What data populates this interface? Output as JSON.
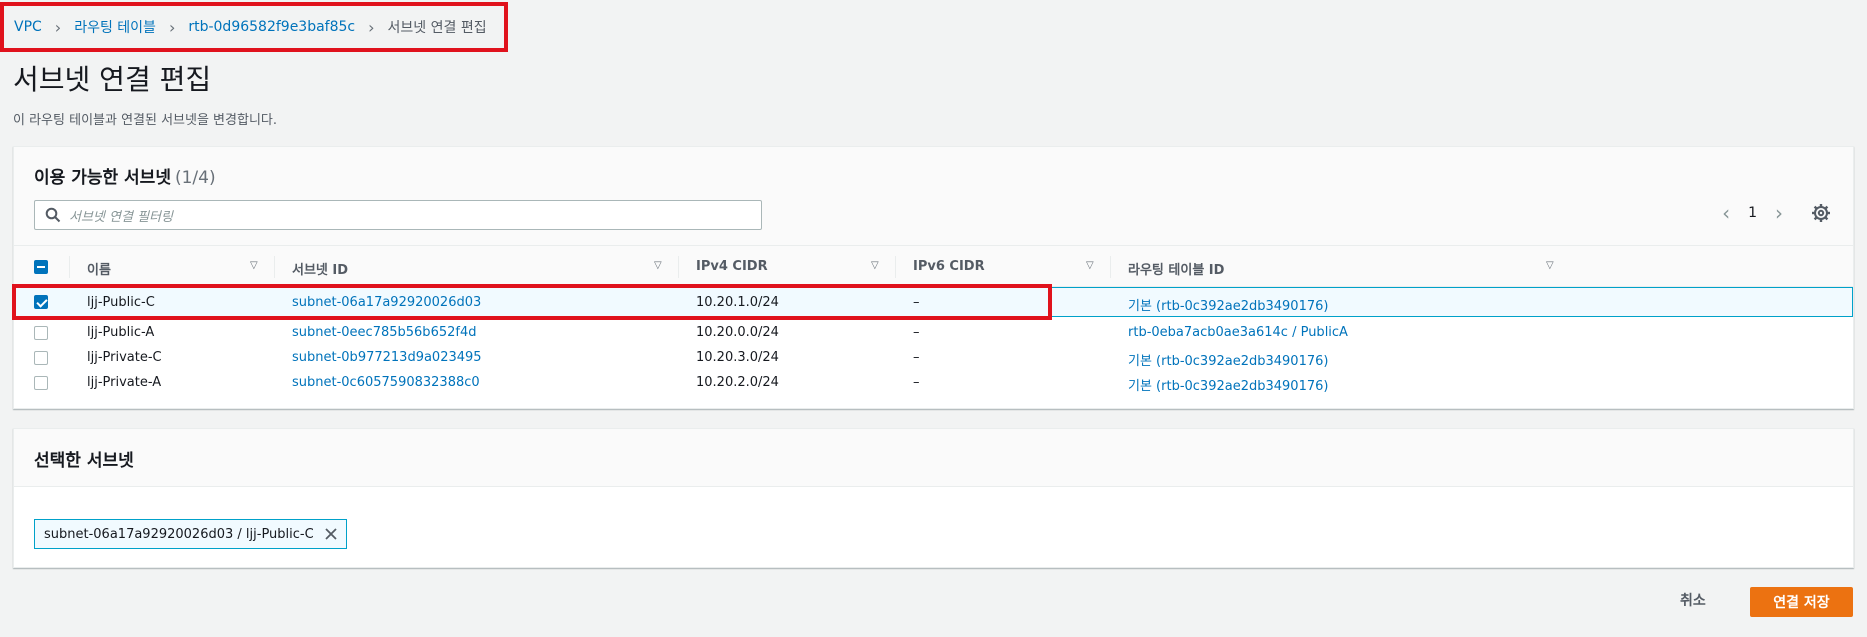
{
  "breadcrumb": {
    "items": [
      "VPC",
      "라우팅 테이블",
      "rtb-0d96582f9e3baf85c"
    ],
    "current": "서브넷 연결 편집"
  },
  "page": {
    "title": "서브넷 연결 편집",
    "description": "이 라우팅 테이블과 연결된 서브넷을 변경합니다."
  },
  "available": {
    "title": "이용 가능한 서브넷",
    "count": "(1/4)",
    "filter_placeholder": "서브넷 연결 필터링",
    "page": "1",
    "columns": [
      "이름",
      "서브넷 ID",
      "IPv4 CIDR",
      "IPv6 CIDR",
      "라우팅 테이블 ID"
    ],
    "rows": [
      {
        "name": "ljj-Public-C",
        "subnet_id": "subnet-06a17a92920026d03",
        "ipv4": "10.20.1.0/24",
        "ipv6": "–",
        "route_table": "기본 (rtb-0c392ae2db3490176)",
        "checked": true
      },
      {
        "name": "ljj-Public-A",
        "subnet_id": "subnet-0eec785b56b652f4d",
        "ipv4": "10.20.0.0/24",
        "ipv6": "–",
        "route_table": "rtb-0eba7acb0ae3a614c / PublicA",
        "checked": false
      },
      {
        "name": "ljj-Private-C",
        "subnet_id": "subnet-0b977213d9a023495",
        "ipv4": "10.20.3.0/24",
        "ipv6": "–",
        "route_table": "기본 (rtb-0c392ae2db3490176)",
        "checked": false
      },
      {
        "name": "ljj-Private-A",
        "subnet_id": "subnet-0c6057590832388c0",
        "ipv4": "10.20.2.0/24",
        "ipv6": "–",
        "route_table": "기본 (rtb-0c392ae2db3490176)",
        "checked": false
      }
    ]
  },
  "selected": {
    "title": "선택한 서브넷",
    "token": "subnet-06a17a92920026d03 / ljj-Public-C"
  },
  "actions": {
    "cancel": "취소",
    "save": "연결 저장"
  },
  "colors": {
    "link": "#0073bb",
    "primary": "#ec7211",
    "highlight_border": "#e0121c"
  }
}
